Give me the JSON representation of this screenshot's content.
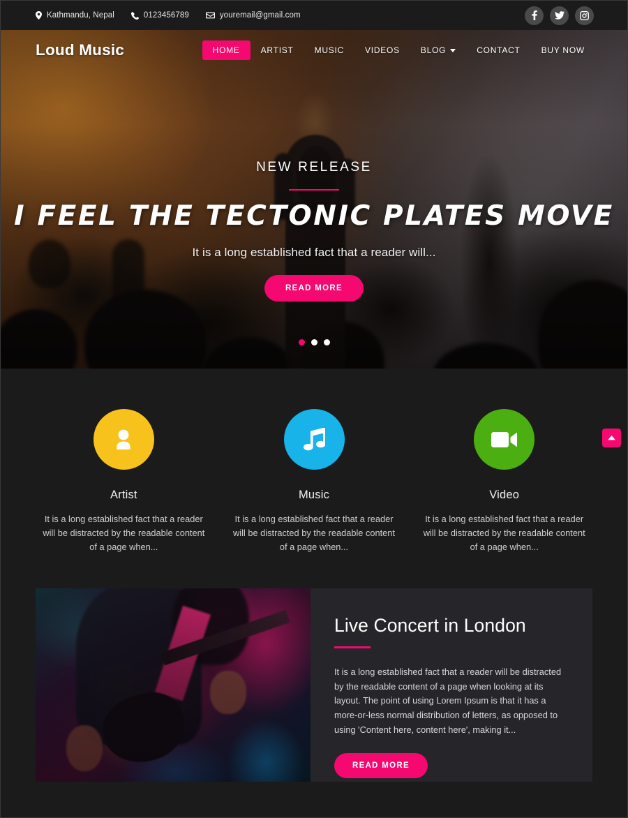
{
  "topbar": {
    "location": "Kathmandu, Nepal",
    "phone": "0123456789",
    "email": "youremail@gmail.com",
    "social": [
      {
        "name": "facebook",
        "glyph": "f"
      },
      {
        "name": "twitter",
        "glyph": "t"
      },
      {
        "name": "instagram",
        "glyph": "i"
      }
    ]
  },
  "header": {
    "logo": "Loud Music",
    "nav": [
      {
        "label": "HOME",
        "active": true,
        "caret": false
      },
      {
        "label": "ARTIST",
        "active": false,
        "caret": false
      },
      {
        "label": "MUSIC",
        "active": false,
        "caret": false
      },
      {
        "label": "VIDEOS",
        "active": false,
        "caret": false
      },
      {
        "label": "BLOG",
        "active": false,
        "caret": true
      },
      {
        "label": "CONTACT",
        "active": false,
        "caret": false
      },
      {
        "label": "BUY NOW",
        "active": false,
        "caret": false
      }
    ]
  },
  "hero": {
    "kicker": "NEW RELEASE",
    "title": "I FEEL THE TECTONIC PLATES MOVE",
    "subtitle": "It is a long established fact that a reader will...",
    "button": "READ MORE",
    "slides": 3,
    "active_slide": 1
  },
  "features": [
    {
      "icon": "user-icon",
      "color": "#f7c21b",
      "title": "Artist",
      "text": "It is a long established fact that a reader will be distracted by the readable content of a page when..."
    },
    {
      "icon": "music-note-icon",
      "color": "#18b3e8",
      "title": "Music",
      "text": "It is a long established fact that a reader will be distracted by the readable content of a page when..."
    },
    {
      "icon": "video-camera-icon",
      "color": "#4caf11",
      "title": "Video",
      "text": "It is a long established fact that a reader will be distracted by the readable content of a page when..."
    }
  ],
  "concert": {
    "title": "Live Concert in London",
    "text": "It is a long established fact that a reader will be distracted by the readable content of a page when looking at its layout. The point of using Lorem Ipsum is that it has a more-or-less normal distribution of letters, as opposed to using 'Content here, content here', making it...",
    "button": "READ MORE",
    "image_alt": "guitarist performing on stage"
  },
  "scroll_top": {
    "label": "Back to top"
  },
  "colors": {
    "accent": "#f5086f",
    "page_bg": "#1b1b1b",
    "card_bg": "#26262a",
    "social_bg": "#4a4a4a"
  }
}
